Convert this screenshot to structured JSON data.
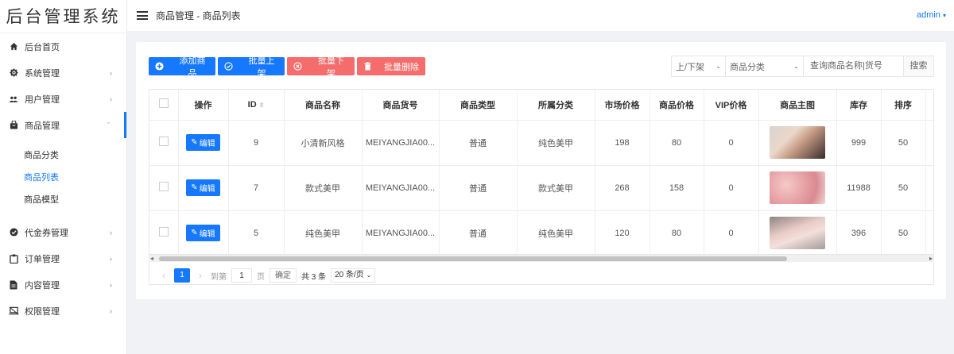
{
  "sidebar": {
    "logo": "后台管理系统",
    "items": [
      {
        "label": "后台首页"
      },
      {
        "label": "系统管理"
      },
      {
        "label": "用户管理"
      },
      {
        "label": "商品管理"
      },
      {
        "label": "代金券管理"
      },
      {
        "label": "订单管理"
      },
      {
        "label": "内容管理"
      },
      {
        "label": "权限管理"
      }
    ],
    "submenu": [
      {
        "label": "商品分类"
      },
      {
        "label": "商品列表"
      },
      {
        "label": "商品模型"
      }
    ]
  },
  "header": {
    "breadcrumb": "商品管理 - 商品列表",
    "user": "admin"
  },
  "toolbar": {
    "add_label": "添加商品",
    "batch_on_label": "批量上架",
    "batch_off_label": "批量下架",
    "batch_delete_label": "批量删除"
  },
  "filters": {
    "status_select": "上/下架",
    "category_select": "商品分类",
    "search_placeholder": "查询商品名称|货号",
    "search_button": "搜索"
  },
  "table": {
    "columns": [
      "操作",
      "ID",
      "商品名称",
      "商品货号",
      "商品类型",
      "所属分类",
      "市场价格",
      "商品价格",
      "VIP价格",
      "商品主图",
      "库存",
      "排序"
    ],
    "edit_label": "编辑",
    "rows": [
      {
        "id": "9",
        "name": "小清新风格",
        "sku": "MEIYANGJIA00...",
        "type": "普通",
        "category": "纯色美甲",
        "market_price": "198",
        "price": "80",
        "vip_price": "0",
        "stock": "999",
        "sort": "50"
      },
      {
        "id": "7",
        "name": "款式美甲",
        "sku": "MEIYANGJIA00...",
        "type": "普通",
        "category": "款式美甲",
        "market_price": "268",
        "price": "158",
        "vip_price": "0",
        "stock": "11988",
        "sort": "50"
      },
      {
        "id": "5",
        "name": "纯色美甲",
        "sku": "MEIYANGJIA00...",
        "type": "普通",
        "category": "纯色美甲",
        "market_price": "120",
        "price": "80",
        "vip_price": "0",
        "stock": "396",
        "sort": "50"
      }
    ]
  },
  "pagination": {
    "current": "1",
    "goto_label": "到第",
    "goto_value": "1",
    "page_unit": "页",
    "confirm": "确定",
    "total": "共 3 条",
    "page_size": "20 条/页"
  },
  "colors": {
    "accent": "#1677ff",
    "danger": "#f56c6c"
  }
}
